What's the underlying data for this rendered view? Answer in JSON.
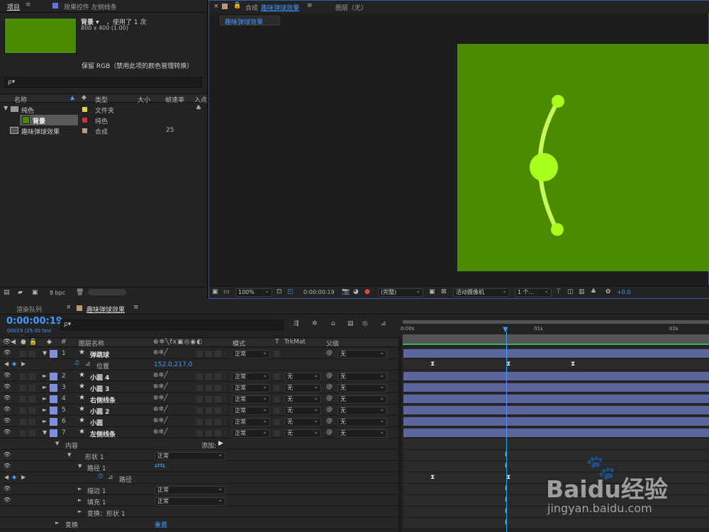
{
  "project_panel": {
    "tabs": [
      "项目",
      "效果控件 左侧线条"
    ],
    "preview": {
      "name": "背景",
      "used": "，使用了 1 次",
      "dims": "800 x 400 (1.00)",
      "color": "#4c8a00"
    },
    "color_note": "保留 RGB（禁用此项的颜色管理转换）",
    "search_placeholder": "ρ▾",
    "columns": [
      "名称",
      "类型",
      "大小",
      "帧速率",
      "入点"
    ],
    "items": [
      {
        "name": "纯色",
        "type": "文件夹",
        "fps": "",
        "swatch": "#e2d04a",
        "level": 0,
        "folder": true
      },
      {
        "name": "背景",
        "type": "纯色",
        "fps": "",
        "swatch": "#c83434",
        "level": 1,
        "selected": true
      },
      {
        "name": "趣味弹球效果",
        "type": "合成",
        "fps": "25",
        "swatch": "#b89a7a",
        "level": 0
      }
    ],
    "bpc": "8 bpc"
  },
  "comp_panel": {
    "tab_close": "×",
    "tab_label": "合成",
    "tab_name": "趣味弹球效果",
    "layer_tab": "图层（无）",
    "subtab": "趣味弹球效果",
    "bg": "#4c8a00",
    "toolbar": {
      "zoom": "100%",
      "timecode": "0:00:00:19",
      "quality": "(完整)",
      "camera": "活动摄像机",
      "views": "1 个...",
      "exposure": "+0.0"
    }
  },
  "timeline": {
    "render_tab": "渲染队列",
    "comp_tab": "趣味弹球效果",
    "timecode": "0:00:00:19",
    "frame_info": "00019 (25.00 fps)",
    "search_placeholder": "ρ▾",
    "headers": {
      "num": "#",
      "name": "图层名称",
      "mode": "模式",
      "t": "T",
      "trkmat": "TrkMat",
      "parent": "父级"
    },
    "ruler": [
      "0:00s",
      "01s",
      "02s"
    ],
    "layers": [
      {
        "num": "1",
        "name": "弹跳球",
        "mode": "正常",
        "trk": "",
        "parent": "无",
        "open": true
      },
      {
        "num": "2",
        "name": "小圆 4",
        "mode": "正常",
        "trk": "无",
        "parent": "无"
      },
      {
        "num": "3",
        "name": "小圆 3",
        "mode": "正常",
        "trk": "无",
        "parent": "无"
      },
      {
        "num": "4",
        "name": "右侧线条",
        "mode": "正常",
        "trk": "无",
        "parent": "无"
      },
      {
        "num": "5",
        "name": "小圆 2",
        "mode": "正常",
        "trk": "无",
        "parent": "无"
      },
      {
        "num": "6",
        "name": "小圆",
        "mode": "正常",
        "trk": "无",
        "parent": "无"
      },
      {
        "num": "7",
        "name": "左侧线条",
        "mode": "正常",
        "trk": "无",
        "parent": "无",
        "open": true
      }
    ],
    "position_prop": {
      "label": "位置",
      "value": "152.0,217.0"
    },
    "content": {
      "label": "内容",
      "add": "添加:"
    },
    "shape1": {
      "label": "形状 1",
      "mode": "正常"
    },
    "path1": {
      "label": "路径 1"
    },
    "path": {
      "label": "路径"
    },
    "stroke": {
      "label": "描边 1",
      "mode": "正常"
    },
    "fill": {
      "label": "填充 1",
      "mode": "正常"
    },
    "transform_shape": {
      "label": "变换：形状 1"
    },
    "transform": {
      "label": "变换",
      "reset": "重置"
    }
  },
  "colors": {
    "accent": "#3e9bff",
    "layer_label": "#7f8fe0",
    "bar": "#5b669c",
    "green_bg": "#4c8a00"
  },
  "watermark": {
    "brand": "Baidu经验",
    "url": "jingyan.baidu.com"
  }
}
